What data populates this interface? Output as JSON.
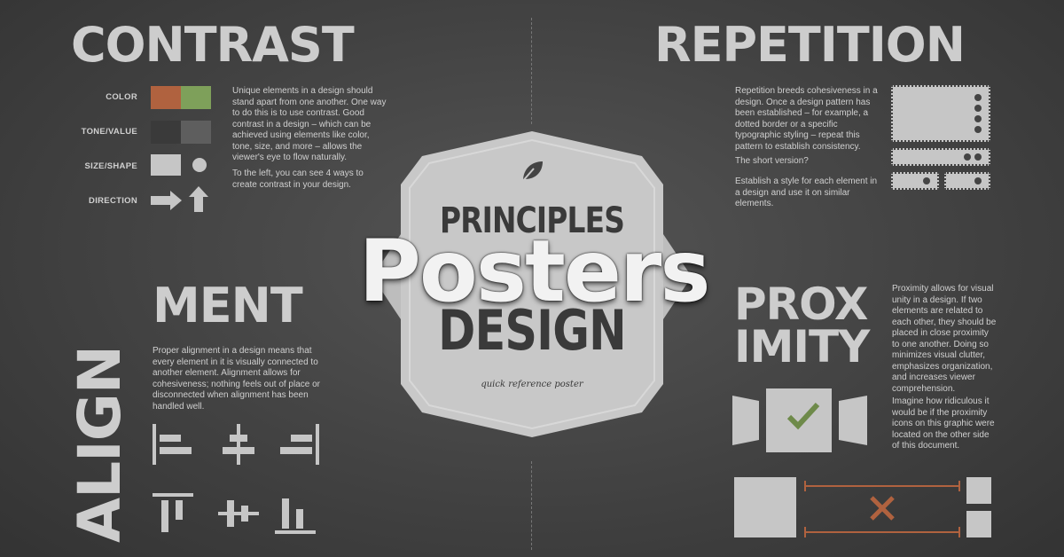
{
  "contrast": {
    "title": "CONTRAST",
    "labels": [
      "COLOR",
      "TONE/VALUE",
      "SIZE/SHAPE",
      "DIRECTION"
    ],
    "paragraph1": "Unique elements in a design should stand apart from one another. One way to do this is to use contrast. Good contrast in a design – which can be achieved using elements like color, tone, size, and more – allows the viewer's eye to flow naturally.",
    "paragraph2": "To the left, you can see 4 ways to create contrast in your design.",
    "color_a": "#b0623f",
    "color_b": "#7ea05a"
  },
  "repetition": {
    "title": "REPETITION",
    "paragraph1": "Repetition breeds cohesiveness in a design. Once a design pattern has been established – for example, a dotted border or a specific typographic styling – repeat this pattern to establish consistency.",
    "paragraph2": "The short version?",
    "paragraph3": "Establish a style for each element in a design and use it on similar elements."
  },
  "alignment": {
    "title_vertical": "ALIGN",
    "title_horizontal": "MENT",
    "paragraph": "Proper alignment in a design means that every element in it is visually connected to another element. Alignment allows for cohesiveness; nothing feels out of place or disconnected when alignment has been handled well."
  },
  "proximity": {
    "title_line1": "PROX",
    "title_line2": "IMITY",
    "paragraph1": "Proximity allows for visual unity in a design. If two elements are related to each other, they should be placed in close proximity to one another. Doing so minimizes visual clutter, emphasizes organization, and increases viewer comprehension.",
    "paragraph2": "Imagine how ridiculous it would be if the proximity icons on this graphic were located on the other side of this document.",
    "check_color": "#6e8a4a",
    "x_color": "#b0623f"
  },
  "badge": {
    "line1": "PRINCIPLES",
    "line2": "DESIGN",
    "subtitle": "quick reference poster"
  },
  "overlay": {
    "text": "Posters"
  }
}
